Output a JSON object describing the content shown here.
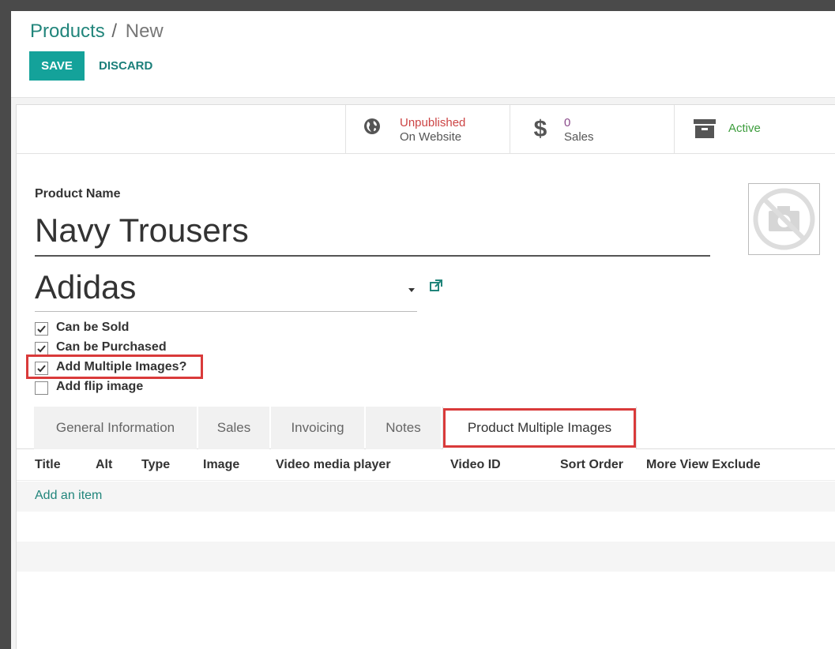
{
  "breadcrumb": {
    "parent": "Products",
    "separator": "/",
    "current": "New"
  },
  "actions": {
    "save": "SAVE",
    "discard": "DISCARD"
  },
  "stats": {
    "website": {
      "status": "Unpublished",
      "label": "On Website",
      "icon": "globe-icon"
    },
    "sales": {
      "count": "0",
      "label": "Sales",
      "icon": "dollar-icon"
    },
    "active": {
      "label": "Active",
      "icon": "archive-icon"
    }
  },
  "product": {
    "name_label": "Product Name",
    "name": "Navy Trousers",
    "brand": "Adidas",
    "image_placeholder_icon": "no-camera-icon"
  },
  "options": [
    {
      "label": "Can be Sold",
      "checked": true
    },
    {
      "label": "Can be Purchased",
      "checked": true
    },
    {
      "label": "Add Multiple Images?",
      "checked": true
    },
    {
      "label": "Add flip image",
      "checked": false
    }
  ],
  "tabs": [
    {
      "label": "General Information"
    },
    {
      "label": "Sales"
    },
    {
      "label": "Invoicing"
    },
    {
      "label": "Notes"
    },
    {
      "label": "Product Multiple Images"
    }
  ],
  "table": {
    "columns": [
      "Title",
      "Alt",
      "Type",
      "Image",
      "Video media player",
      "Video ID",
      "Sort Order",
      "More View Exclude"
    ],
    "add_item": "Add an item"
  },
  "colors": {
    "accent": "#14a29a",
    "link": "#21857b",
    "unpublished": "#cc4444",
    "active": "#3d9d3d",
    "highlight": "#d93a3a"
  }
}
